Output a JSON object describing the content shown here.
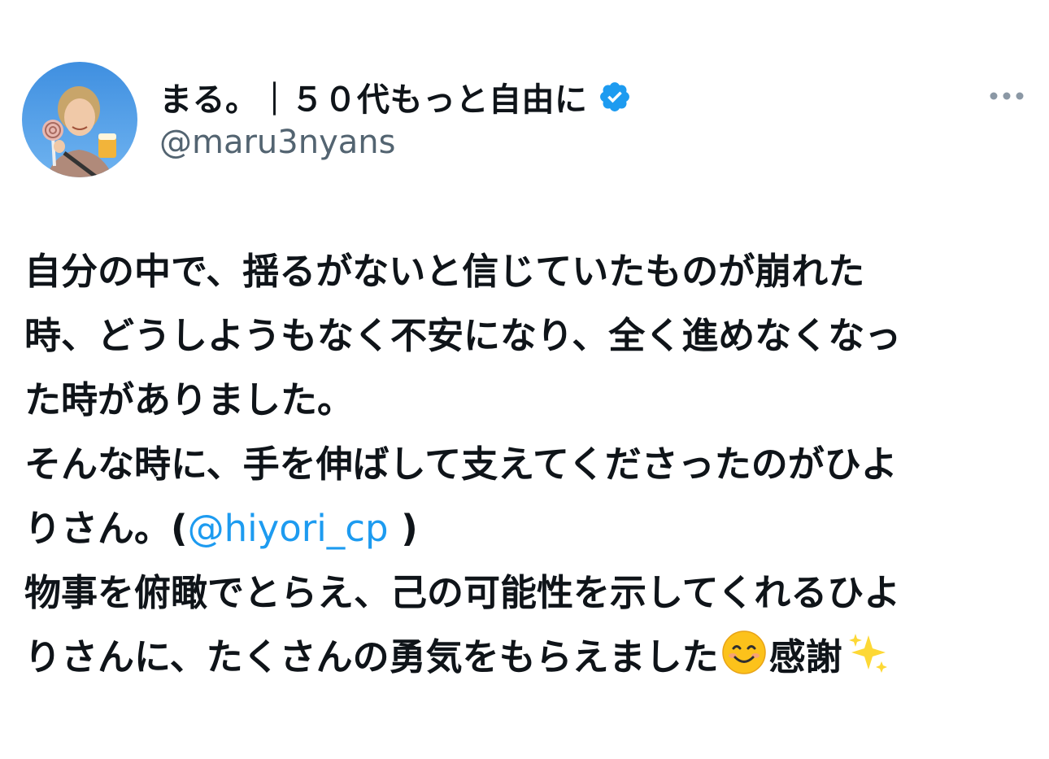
{
  "author": {
    "display_name": "まる。｜５０代もっと自由に",
    "handle": "@maru3nyans",
    "verified": true,
    "avatar_icon": "user-avatar-photo"
  },
  "colors": {
    "text": "#0f1419",
    "secondary": "#536471",
    "link": "#1d9bf0",
    "badge": "#1d9bf0"
  },
  "tweet": {
    "line1": "自分の中で、揺るがないと信じていたものが崩れた",
    "line2": "時、どうしようもなく不安になり、全く進めなくなっ",
    "line3": "た時がありました。",
    "line4": "そんな時に、手を伸ばして支えてくださったのがひよ",
    "line5_prefix": "りさん。(",
    "mention": "@hiyori_cp",
    "line5_suffix": " )",
    "line6": "物事を俯瞰でとらえ、己の可能性を示してくれるひよ",
    "line7_text": "りさんに、たくさんの勇気をもらえました",
    "line7_after_emoji": "感謝",
    "emoji1": "smiling-face-emoji",
    "emoji2": "sparkles-emoji"
  }
}
